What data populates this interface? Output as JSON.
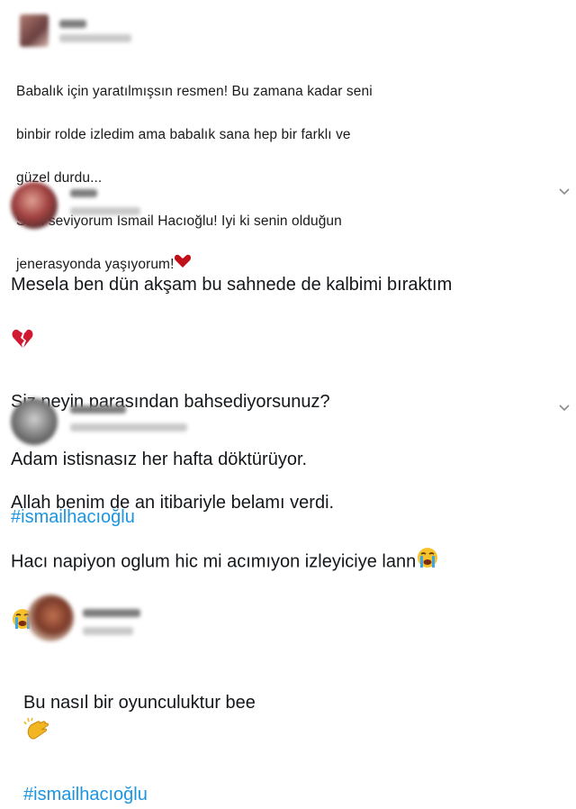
{
  "tweets": [
    {
      "lines": [
        "Babalık için yaratılmışsın resmen! Bu zamana kadar seni",
        "binbir rolde izledim ama babalık sana hep bir farklı ve",
        "güzel durdu...",
        "Seni seviyorum Ismail Hacıoğlu! Iyi ki senin olduğun",
        "jenerasyonda yaşıyorum!"
      ],
      "end_emoji": "heart-icon"
    },
    {
      "line1": "Mesela ben dün akşam bu sahnede de kalbimi bıraktım",
      "line1_emoji": "broken-heart-icon",
      "line2": "Siz neyin parasından bahsediyorsunuz?",
      "line3": "Adam istisnasız her hafta döktürüyor.",
      "hashtag": "#ismailhacıoğlu"
    },
    {
      "line1": "Allah benim de an itibariyle belamı verdi.",
      "line2": "Hacı napiyon oglum hic mi acımıyon izleyiciye lann",
      "emoji": "crying-face-icon"
    },
    {
      "line1": "Bu nasıl bir oyunculuktur bee",
      "emoji": "clapping-hands-icon",
      "hashtag": "#ismailhacıoğlu"
    }
  ],
  "colors": {
    "hashtag": "#1b95e0",
    "text": "#14171a",
    "heart": "#c0101a"
  }
}
